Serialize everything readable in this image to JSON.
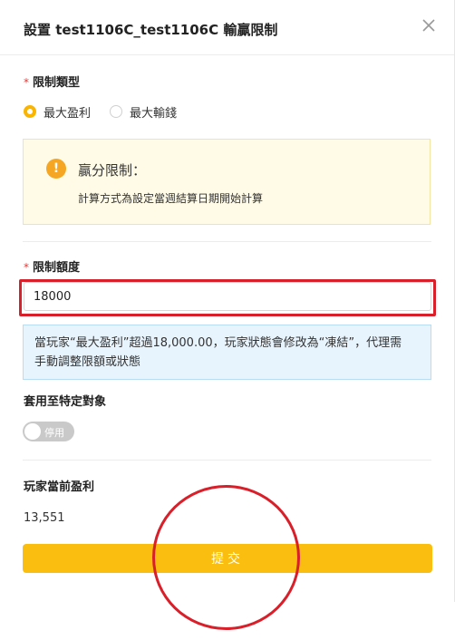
{
  "modal": {
    "title": "設置 test1106C_test1106C 輸贏限制"
  },
  "limit_type": {
    "label": "限制類型",
    "options": [
      {
        "label": "最大盈利",
        "selected": true
      },
      {
        "label": "最大輸錢",
        "selected": false
      }
    ]
  },
  "win_limit_notice": {
    "title": "贏分限制：",
    "description": "計算方式為設定當週結算日期開始計算"
  },
  "limit_amount": {
    "label": "限制額度",
    "value": "18000"
  },
  "info_notice": {
    "line1": "當玩家“最大盈利”超過18,000.00，玩家狀態會修改為“凍結”，代理需",
    "line2": "手動調整限額或狀態"
  },
  "apply_target": {
    "label": "套用至特定對象",
    "toggle_text": "停用",
    "enabled": false
  },
  "current_profit": {
    "label": "玩家當前盈利",
    "value": "13,551"
  },
  "submit": {
    "label": "提交"
  },
  "colors": {
    "accent": "#f9be0f",
    "radio_selected": "#f9b500",
    "annotation_red": "#d9202a",
    "warning_bg": "#fffbe6",
    "info_bg": "#e8f4fd"
  }
}
